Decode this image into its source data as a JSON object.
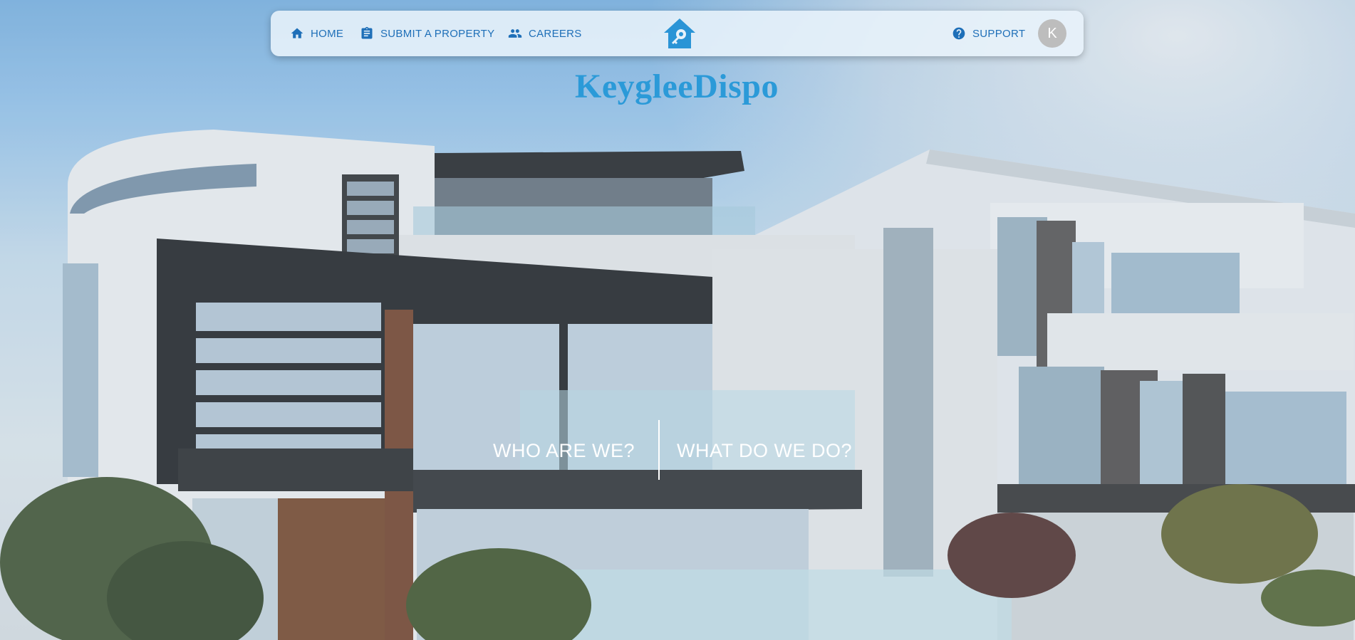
{
  "nav": {
    "items": [
      {
        "label": "HOME",
        "icon": "home-icon"
      },
      {
        "label": "SUBMIT A PROPERTY",
        "icon": "assignment-icon"
      },
      {
        "label": "CAREERS",
        "icon": "people-icon"
      }
    ],
    "support": {
      "label": "SUPPORT",
      "icon": "help-circle-icon"
    },
    "logo_icon": "house-key-logo-icon",
    "avatar_initial": "K"
  },
  "brand": {
    "title": "KeygleeDispo"
  },
  "hero": {
    "cta_left": "WHO ARE WE?",
    "cta_right": "WHAT DO WE DO?",
    "background": "modern-house-photo"
  },
  "colors": {
    "accent": "#1e6fb8",
    "brand": "#2b9ad8",
    "logo": "#2a94d6",
    "navbar_bg": "#e8f2fa",
    "avatar_bg": "#bdbdbd"
  }
}
